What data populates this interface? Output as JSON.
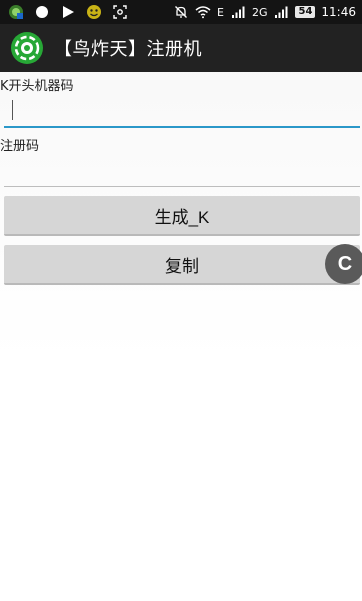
{
  "status_bar": {
    "left_icons": [
      "app-notification-icon",
      "dot-icon",
      "play-icon",
      "emoji-icon",
      "screenshot-icon"
    ],
    "right_icons": [
      "mute-bell-icon",
      "wifi-icon",
      "signal-icon",
      "signal-2g-icon",
      "signal-icon"
    ],
    "net_e": "E",
    "net_2g": "2G",
    "battery": "54",
    "time": "11:46"
  },
  "app_bar": {
    "icon": "shutter-logo-icon",
    "title": "【鸟炸天】注册机",
    "icon_color": "#27a836"
  },
  "form": {
    "machine_code_label": "K开头机器码",
    "machine_code_value": "",
    "registration_label": "注册码",
    "registration_value": ""
  },
  "buttons": {
    "generate_label": "生成_K",
    "copy_label": "复制"
  },
  "floating_widget": {
    "icon": "c-icon",
    "letter": "C"
  },
  "colors": {
    "focus_line": "#2b98c9",
    "button_bg": "#d6d6d6",
    "app_bar_bg": "#222222"
  }
}
